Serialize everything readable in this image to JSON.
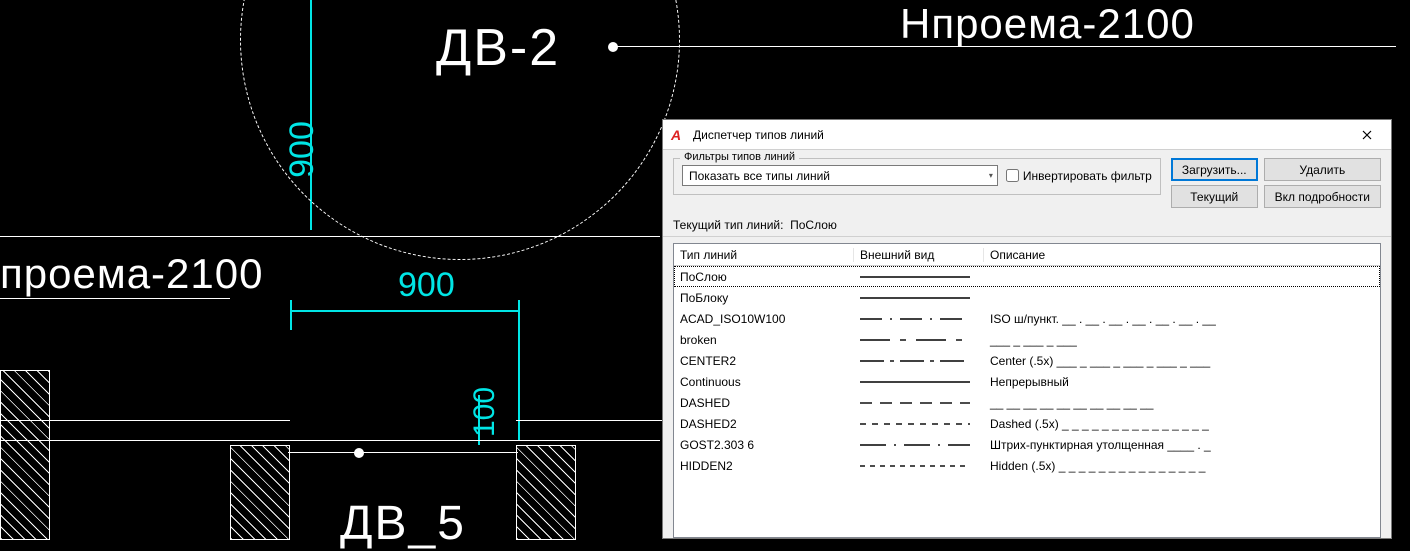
{
  "cad": {
    "label_dv2": "ДВ-2",
    "label_dv5": "ДВ_5",
    "label_hproema1": "Нпроема-2100",
    "label_hproema2": "проема-2100",
    "dim_900_v": "900",
    "dim_900_h": "900",
    "dim_100": "100"
  },
  "dialog": {
    "title": "Диспетчер типов линий",
    "filters_legend": "Фильтры типов линий",
    "dropdown_value": "Показать все типы линий",
    "invert_filter": "Инвертировать фильтр",
    "btn_load": "Загрузить...",
    "btn_delete": "Удалить",
    "btn_current": "Текущий",
    "btn_details": "Вкл подробности",
    "current_label": "Текущий тип линий:",
    "current_value": "ПоСлою",
    "columns": {
      "name": "Тип линий",
      "appearance": "Внешний вид",
      "description": "Описание"
    },
    "rows": [
      {
        "name": "ПоСлою",
        "pattern": "solid",
        "desc": ""
      },
      {
        "name": "ПоБлоку",
        "pattern": "solid",
        "desc": ""
      },
      {
        "name": "ACAD_ISO10W100",
        "pattern": "dashdot",
        "desc": "ISO ш/пункт. __ . __ . __ . __ . __ . __ . __"
      },
      {
        "name": "broken",
        "pattern": "dashlong",
        "desc": "___ _ ___ _ ___"
      },
      {
        "name": "CENTER2",
        "pattern": "center2",
        "desc": "Center (.5x) ___ _ ___ _ ___ _ ___ _ ___"
      },
      {
        "name": "Continuous",
        "pattern": "solid",
        "desc": "Непрерывный"
      },
      {
        "name": "DASHED",
        "pattern": "dashed",
        "desc": "__ __ __ __ __ __ __ __ __ __"
      },
      {
        "name": "DASHED2",
        "pattern": "dashed2",
        "desc": "Dashed (.5x) _ _ _ _ _ _ _ _ _ _ _ _ _ _ _"
      },
      {
        "name": "GOST2.303 6",
        "pattern": "gost",
        "desc": "Штрих-пунктирная утолщенная ____ . _"
      },
      {
        "name": "HIDDEN2",
        "pattern": "hidden2",
        "desc": "Hidden (.5x) _ _ _ _ _ _ _ _ _ _ _ _ _ _ _"
      }
    ]
  }
}
